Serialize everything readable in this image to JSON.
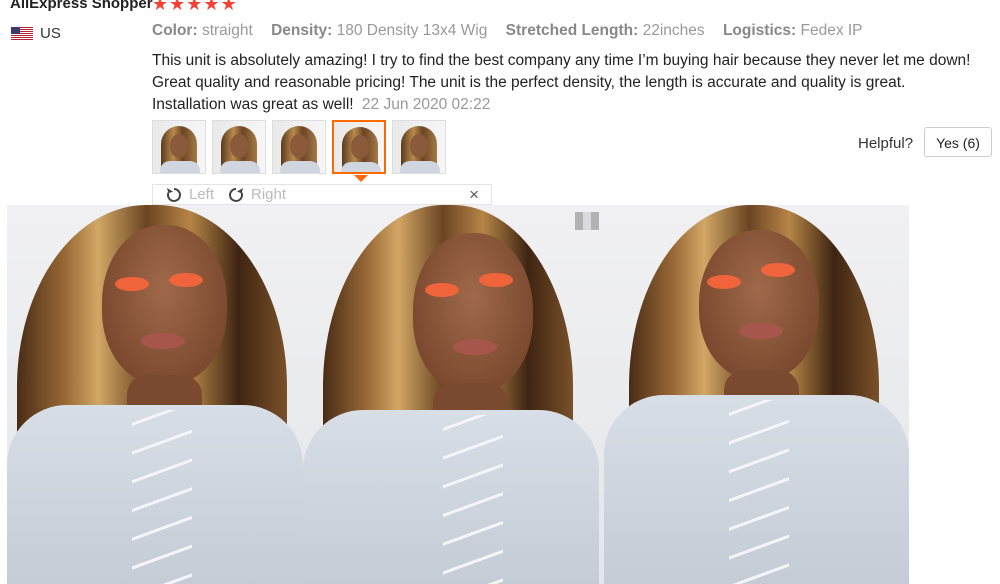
{
  "review": {
    "reviewer_name": "AliExpress Shopper",
    "stars": [
      "★",
      "★",
      "★",
      "★",
      "★"
    ],
    "country": "US",
    "specs": [
      {
        "label": "Color:",
        "value": "straight"
      },
      {
        "label": "Density:",
        "value": "180 Density 13x4 Wig"
      },
      {
        "label": "Stretched Length:",
        "value": "22inches"
      },
      {
        "label": "Logistics:",
        "value": "Fedex IP"
      }
    ],
    "text": "This unit is absolutely amazing! I try to find the best company any time I’m buying hair because they never let me down! Great quality and reasonable pricing! The unit is the perfect density, the length is accurate and quality is great. Installation was great as well!",
    "date": "22 Jun 2020 02:22",
    "helpful_label": "Helpful?",
    "yes_button": "Yes (6)"
  },
  "viewer": {
    "rotate_left_label": "Left",
    "rotate_right_label": "Right",
    "close_symbol": "×",
    "selected_thumbnail_index": 4
  },
  "icons": {
    "rotate_left": "rotate-left-icon",
    "rotate_right": "rotate-right-icon",
    "close": "close-icon",
    "flag": "us-flag-icon"
  },
  "colors": {
    "star": "#f44336",
    "selected_border": "#ff6a00",
    "label_gray": "#888888"
  }
}
